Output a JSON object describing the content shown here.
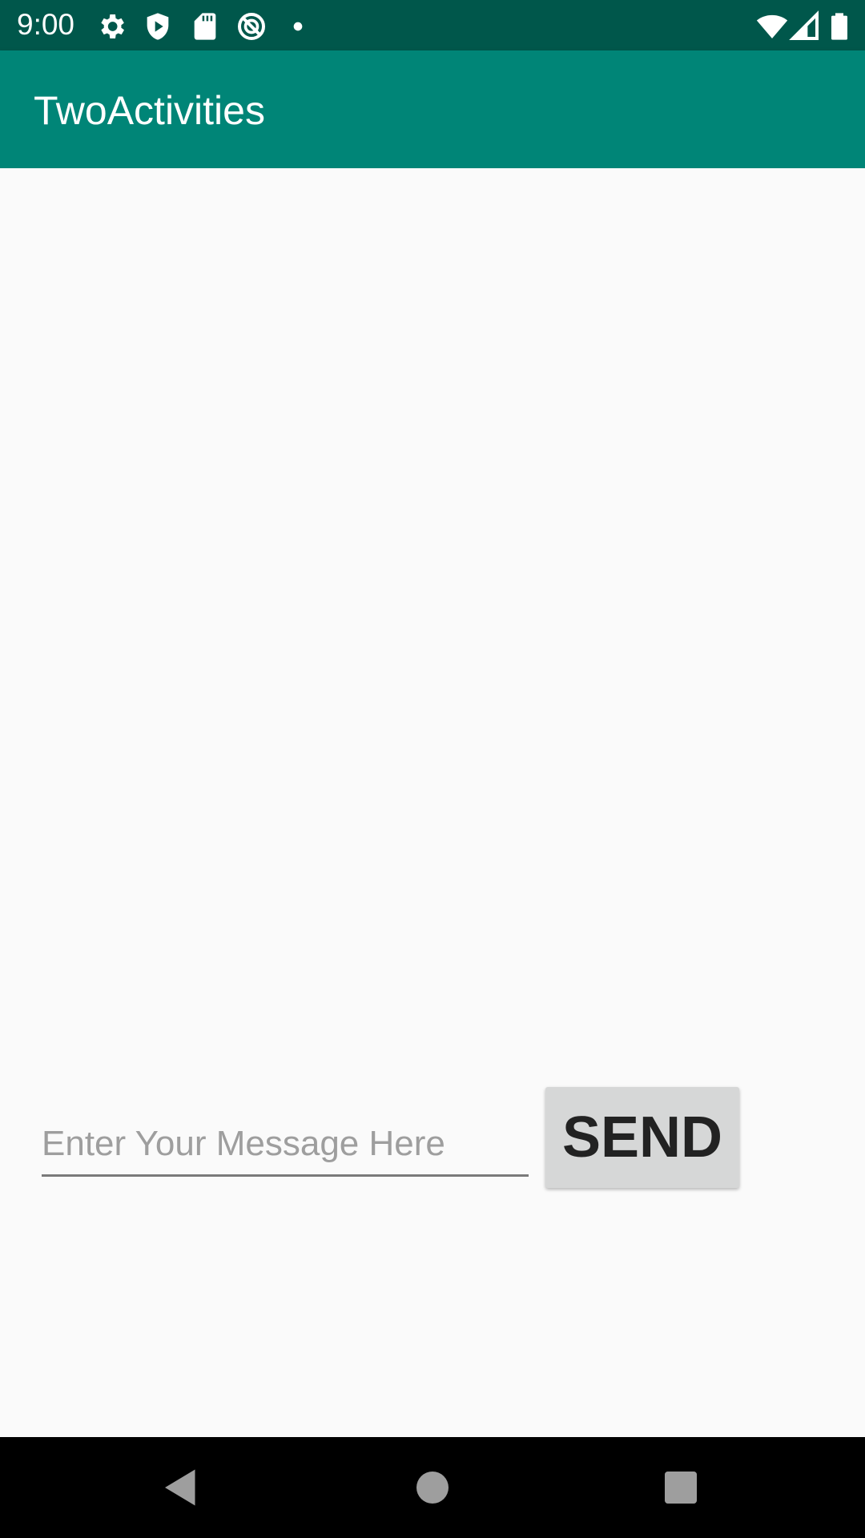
{
  "status_bar": {
    "time": "9:00",
    "icons": [
      "settings-icon",
      "shield-play-icon",
      "sd-card-icon",
      "no-disturb-icon",
      "dot-icon",
      "wifi-icon",
      "signal-icon",
      "battery-icon"
    ],
    "background_color": "#00574b"
  },
  "app_bar": {
    "title": "TwoActivities",
    "background_color": "#008577"
  },
  "main": {
    "message_input": {
      "value": "",
      "placeholder": "Enter Your Message Here"
    },
    "send_button_label": "SEND"
  },
  "nav_bar": {
    "buttons": [
      "back-icon",
      "home-icon",
      "recents-icon"
    ]
  }
}
